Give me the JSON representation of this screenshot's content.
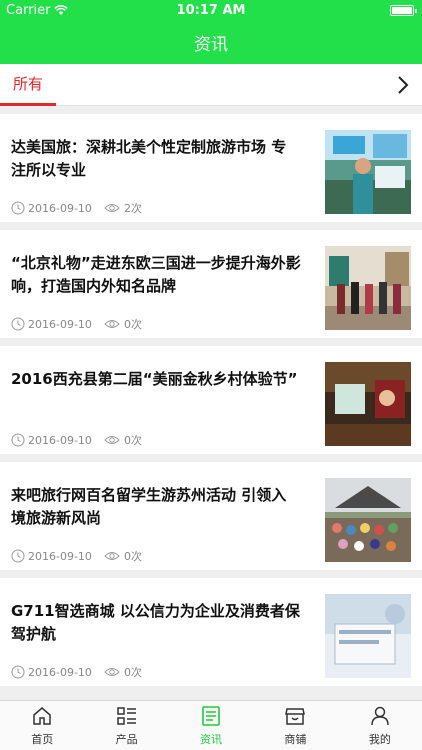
{
  "status_bar": {
    "carrier": "Carrier",
    "time": "10:17 AM",
    "battery_level": 1.0
  },
  "header": {
    "title": "资讯"
  },
  "category_tabs": {
    "active": "所有"
  },
  "articles": [
    {
      "title": "达美国旅：深耕北美个性定制旅游市场 专注所以专业",
      "date": "2016-09-10",
      "views": "2次"
    },
    {
      "title": "“北京礼物”走进东欧三国进一步提升海外影响，打造国内外知名品牌",
      "date": "2016-09-10",
      "views": "0次"
    },
    {
      "title": "2016西充县第二届“美丽金秋乡村体验节”",
      "date": "2016-09-10",
      "views": "0次"
    },
    {
      "title": "来吧旅行网百名留学生游苏州活动 引领入境旅游新风尚",
      "date": "2016-09-10",
      "views": "0次"
    },
    {
      "title": "G711智选商城 以公信力为企业及消费者保驾护航",
      "date": "2016-09-10",
      "views": "0次"
    }
  ],
  "bottom_nav": [
    {
      "label": "首页",
      "icon": "home-icon"
    },
    {
      "label": "产品",
      "icon": "list-icon"
    },
    {
      "label": "资讯",
      "icon": "news-icon",
      "active": true
    },
    {
      "label": "商铺",
      "icon": "shop-icon"
    },
    {
      "label": "我的",
      "icon": "user-icon"
    }
  ],
  "colors": {
    "brand_green": "#22e04a",
    "active_tab_red": "#e02a2a",
    "nav_active_green": "#22c93d"
  }
}
